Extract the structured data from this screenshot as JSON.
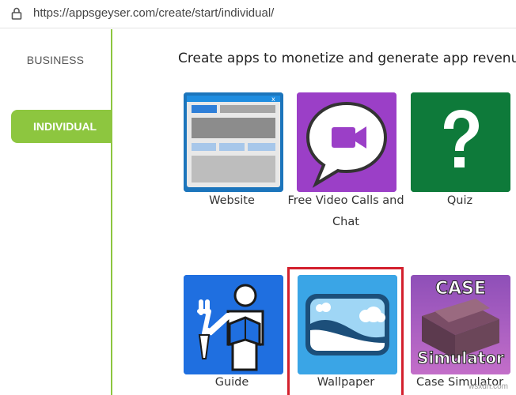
{
  "browser": {
    "url": "https://appsgeyser.com/create/start/individual/"
  },
  "sidebar": {
    "items": [
      {
        "label": "BUSINESS",
        "active": false
      },
      {
        "label": "INDIVIDUAL",
        "active": true
      }
    ]
  },
  "main": {
    "heading": "Create apps to monetize and generate app revenue",
    "tiles": [
      {
        "label": "Website",
        "icon": "website-window-icon",
        "color": "#1c75bc"
      },
      {
        "label": "Free Video Calls and Chat",
        "icon": "video-chat-icon",
        "color": "#9b3fc7"
      },
      {
        "label": "Quiz",
        "icon": "question-mark-icon",
        "color": "#0e7a3a"
      },
      {
        "label": "Guide",
        "icon": "guide-person-icon",
        "color": "#1f6fe0"
      },
      {
        "label": "Wallpaper",
        "icon": "landscape-picture-icon",
        "color": "#3aa5e6",
        "highlighted": true
      },
      {
        "label": "Case Simulator",
        "icon": "case-crate-icon",
        "color": "#b060c0",
        "image_text_1": "CASE",
        "image_text_2": "Simulator"
      }
    ]
  },
  "colors": {
    "accent": "#8dc63f",
    "highlight_border": "#d3202d"
  },
  "watermark": "wsxdn.com"
}
